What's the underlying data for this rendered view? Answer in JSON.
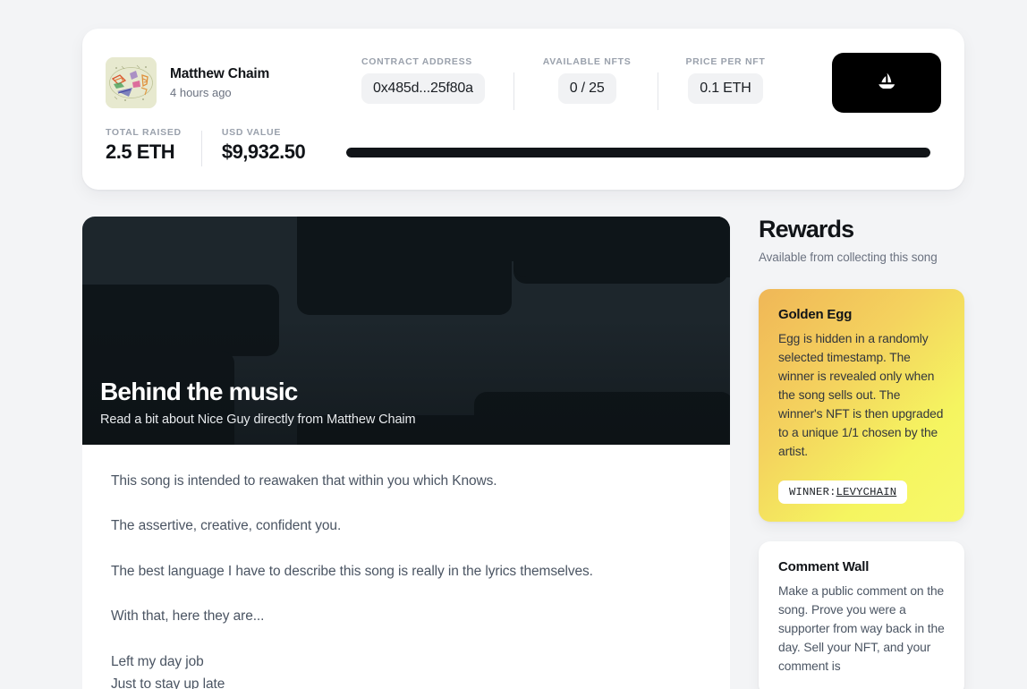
{
  "summary": {
    "artist": {
      "avatar_icon": "abstract-artwork-thumbnail",
      "name": "Matthew Chaim",
      "time_ago": "4 hours ago"
    },
    "stats": [
      {
        "label": "CONTRACT ADDRESS",
        "value": "0x485d...25f80a"
      },
      {
        "label": "AVAILABLE NFTS",
        "value": "0 / 25"
      },
      {
        "label": "PRICE PER NFT",
        "value": "0.1 ETH"
      }
    ],
    "marketplace_button": {
      "icon": "opensea-sailboat-icon",
      "background": "#000000"
    },
    "total_raised": {
      "label": "TOTAL RAISED",
      "value": "2.5 ETH"
    },
    "usd_value": {
      "label": "USD VALUE",
      "value": "$9,932.50"
    },
    "progress": {
      "percent": 100,
      "fill_color": "#111418",
      "track_color": "#eceef1"
    }
  },
  "hero": {
    "title": "Behind the music",
    "subtitle": "Read a bit about Nice Guy directly from Matthew Chaim",
    "base_color": "#1d262c",
    "block_color": "#0e1519"
  },
  "article": {
    "paragraphs": [
      "This song is intended to reawaken that within you which Knows.",
      "The assertive, creative, confident you.",
      "The best language I have to describe this song is really in the lyrics themselves.",
      "With that, here they are..."
    ],
    "lyrics": [
      "Left my day job",
      "Just to stay up late"
    ]
  },
  "sidebar": {
    "title": "Rewards",
    "subtitle": "Available from collecting this song",
    "golden_egg": {
      "title": "Golden Egg",
      "body": "Egg is hidden in a randomly selected timestamp. The winner is revealed only when the song sells out. The winner's NFT is then upgraded to a unique 1/1 chosen by the artist.",
      "winner_label": "WINNER:",
      "winner_name": "LEVYCHAIN",
      "gradient_from": "#f0b757",
      "gradient_to": "#f7f96a"
    },
    "comment_wall": {
      "title": "Comment Wall",
      "body": "Make a public comment on the song. Prove you were a supporter from way back in the day. Sell your NFT, and your comment is"
    }
  }
}
